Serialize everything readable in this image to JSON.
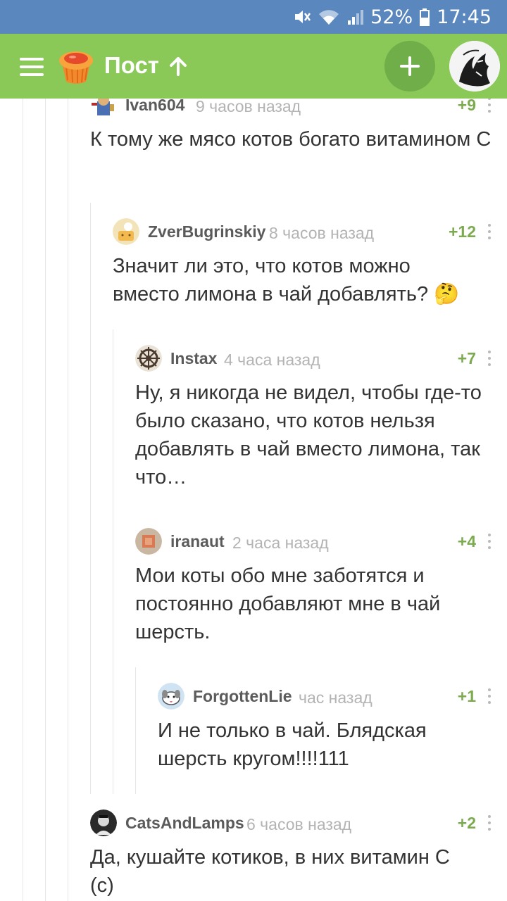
{
  "status_bar": {
    "battery": "52%",
    "time": "17:45",
    "icons": [
      "mute-icon",
      "wifi-icon",
      "signal-icon",
      "battery-icon"
    ]
  },
  "app_bar": {
    "title": "Пост",
    "icons": [
      "menu-icon",
      "pikabu-logo",
      "arrow-up-icon",
      "plus-icon",
      "user-avatar"
    ],
    "accent": "#8ac858"
  },
  "comments": [
    {
      "author": "Ivan604",
      "time": "9 часов назад",
      "rating": "+9",
      "text": "К тому же мясо котов богато витамином С"
    },
    {
      "author": "ZverBugrinskiy",
      "time": "8 часов назад",
      "rating": "+12",
      "text": "Значит ли это, что котов можно вместо лимона в чай добавлять?",
      "emoji": "🤔"
    },
    {
      "author": "Instax",
      "time": "4 часа назад",
      "rating": "+7",
      "text": "Ну, я никогда не видел, чтобы где-то было сказано, что котов нельзя добавлять в чай вместо лимона, так что…"
    },
    {
      "author": "iranaut",
      "time": "2 часа назад",
      "rating": "+4",
      "text": "Мои коты обо мне заботятся и постоянно добавляют мне в чай шерсть."
    },
    {
      "author": "ForgottenLie",
      "time": "час назад",
      "rating": "+1",
      "text": "И не только в чай. Блядская шерсть кругом!!!!111"
    },
    {
      "author": "CatsAndLamps",
      "time": "6 часов назад",
      "rating": "+2",
      "text": "Да, кушайте котиков, в них витамин С (с)"
    }
  ],
  "colors": {
    "status_bar": "#5a87be",
    "rating": "#7cab4f",
    "author": "#5b5b5b",
    "time": "#b3b3b3",
    "text": "#333333"
  }
}
